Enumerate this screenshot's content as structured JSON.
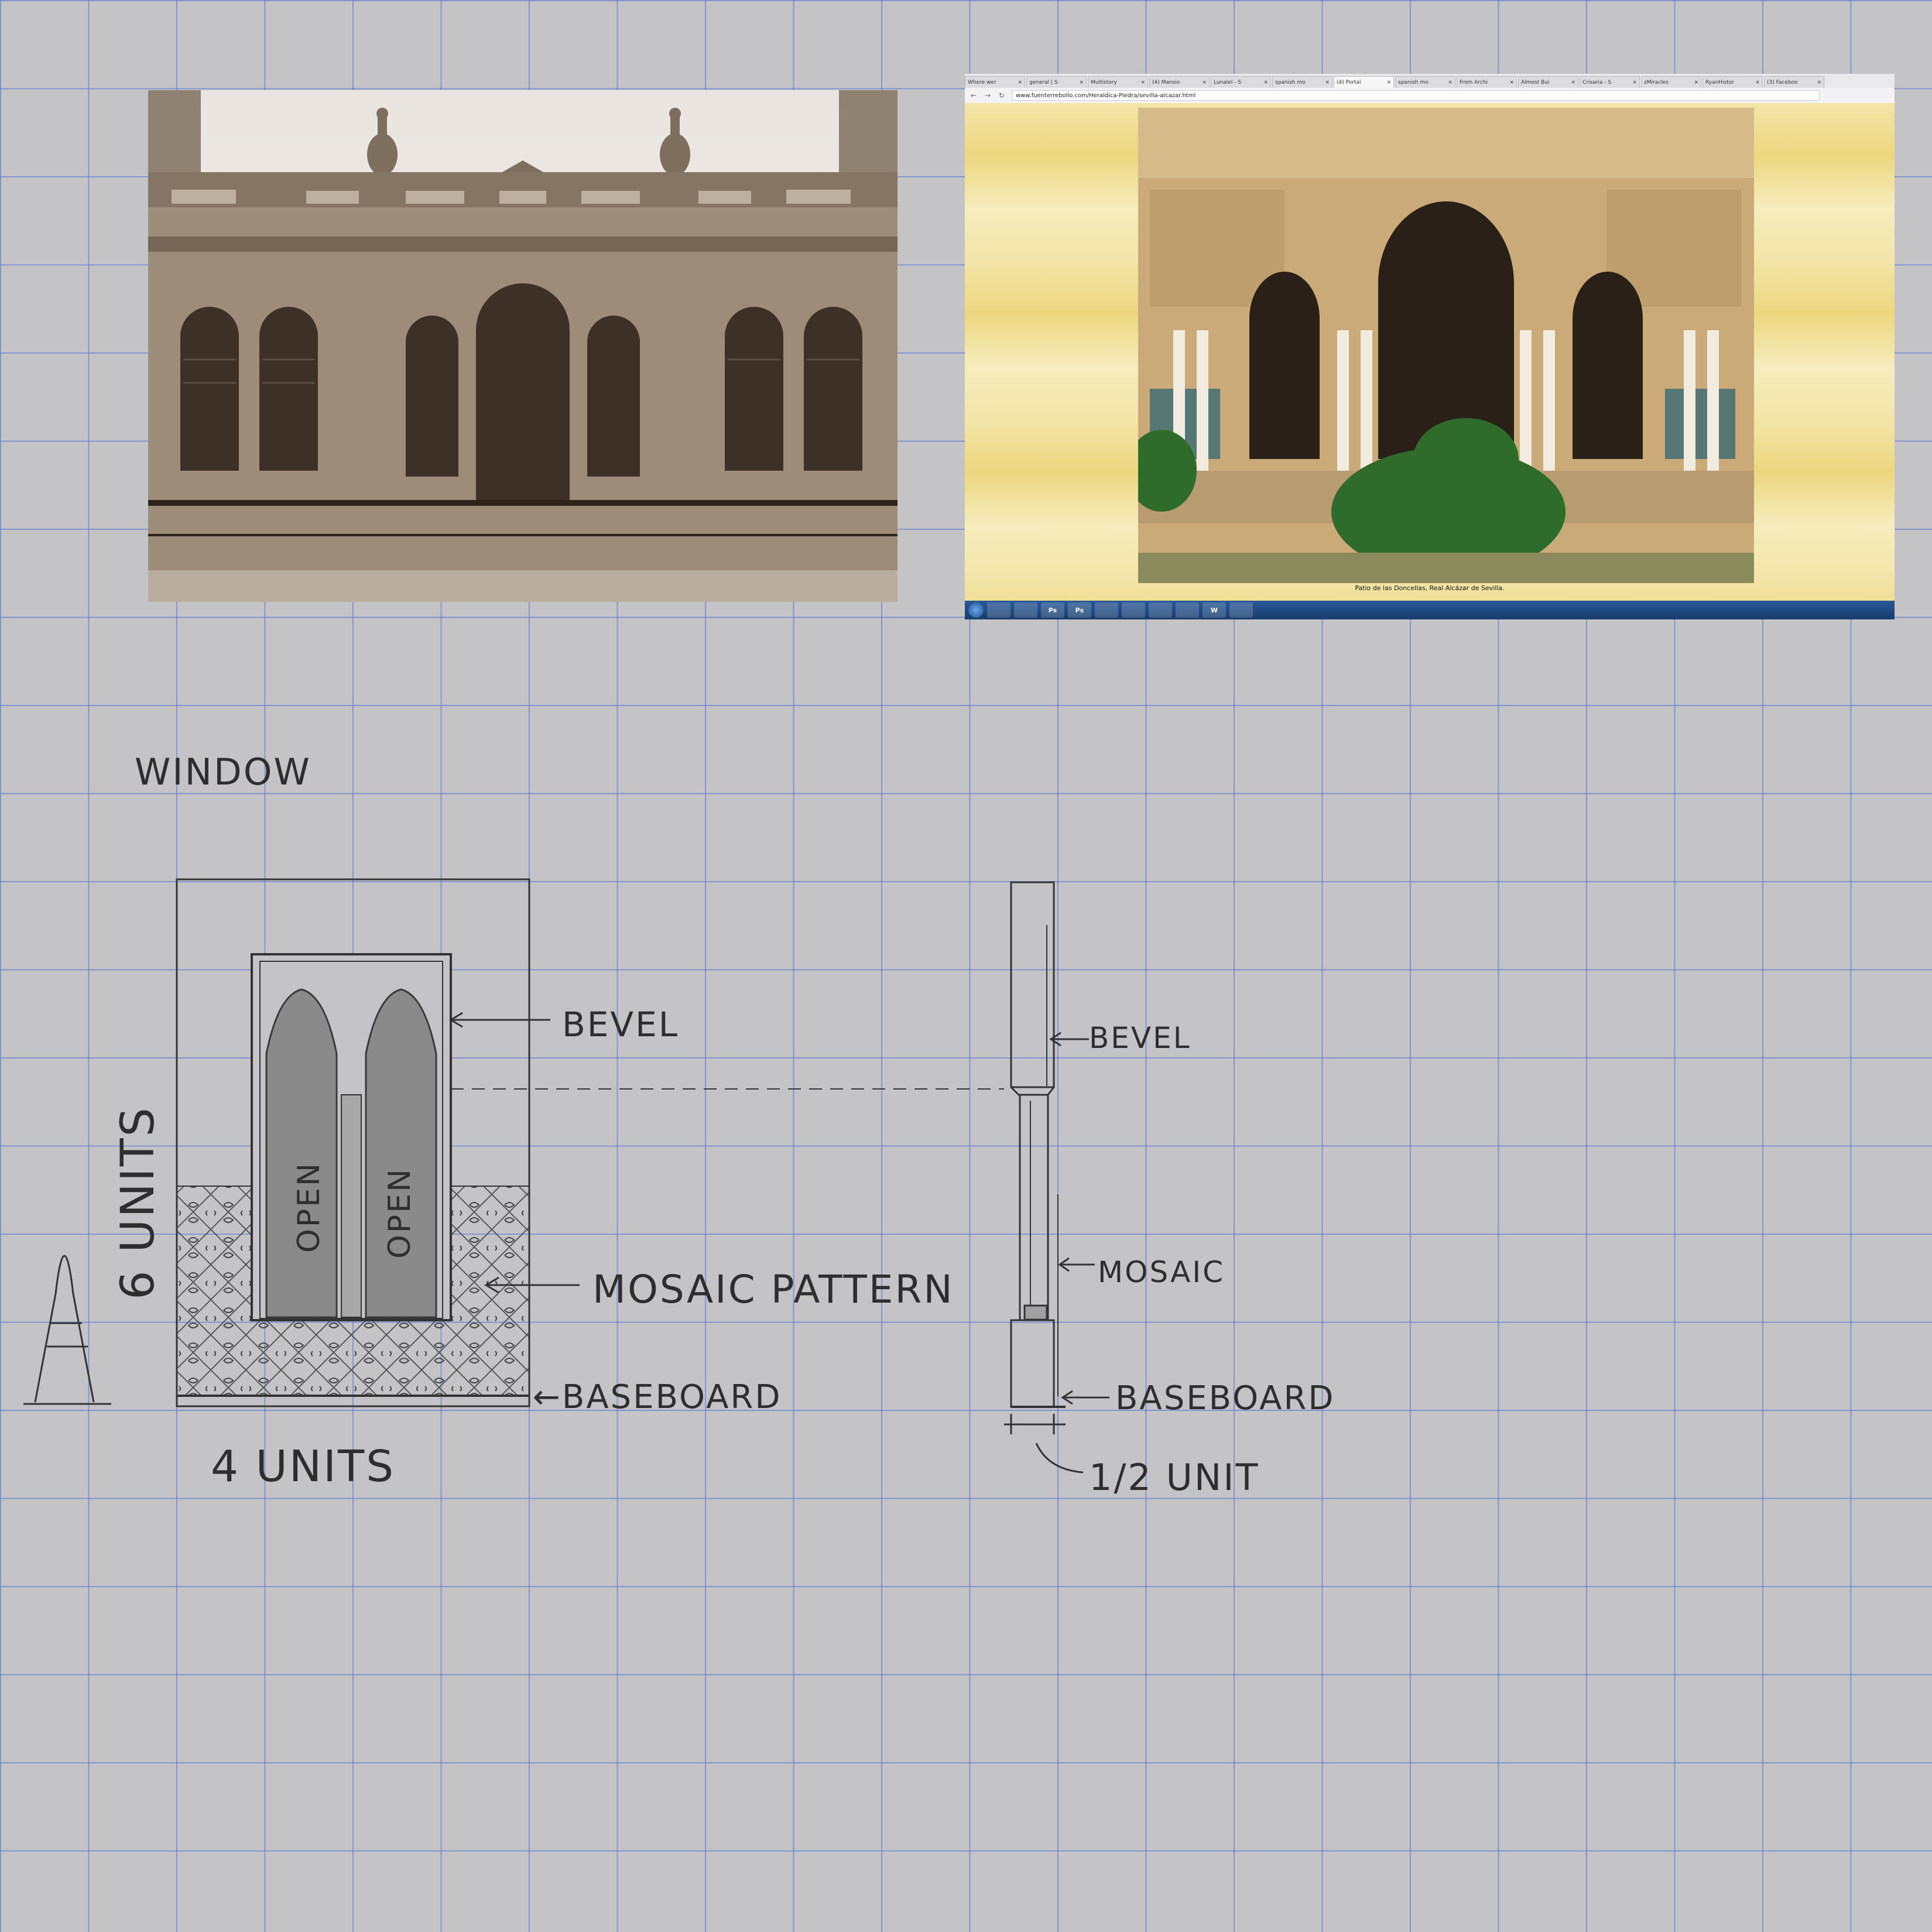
{
  "browser": {
    "tabs": [
      "Where wer",
      "general | S",
      "Multistory",
      "(4) Mansio",
      "Lunalel - S",
      "spanish mo",
      "(4) Portal",
      "spanish mo",
      "From Archi",
      "Almost Bui",
      "Crisaria - S",
      "zMiracles",
      "RyanHistor",
      "(3) Faceboo"
    ],
    "active_tab": 6,
    "tab_close_glyph": "×",
    "back_glyph": "←",
    "forward_glyph": "→",
    "reload_glyph": "↻",
    "url": "www.fuenterrebollo.com/Heraldica-Piedra/sevilla-alcazar.html",
    "caption": "Patio de las Doncellas, Real Alcázar de Sevilla.",
    "taskbar_apps": [
      "",
      "",
      "Ps",
      "Ps",
      "",
      "",
      "",
      "",
      "W",
      ""
    ]
  },
  "sketch": {
    "title": "WINDOW",
    "labels": {
      "bevel_front": "BEVEL",
      "mosaic_pattern": "MOSAIC PATTERN",
      "baseboard_front": "←BASEBOARD",
      "open_left": "OPEN",
      "open_right": "OPEN",
      "height_dim": "6 UNITS",
      "width_dim": "4 UNITS",
      "bevel_side": "BEVEL",
      "mosaic_side": "MOSAIC",
      "baseboard_side": "BASEBOARD",
      "depth_dim": "1/2 UNIT"
    }
  },
  "colors": {
    "paper": "#c4c4c6",
    "grid": "#506ed2",
    "pencil": "#2e2e2e",
    "sepia": "#8a7a66",
    "sandstone": "#c9aa78"
  }
}
